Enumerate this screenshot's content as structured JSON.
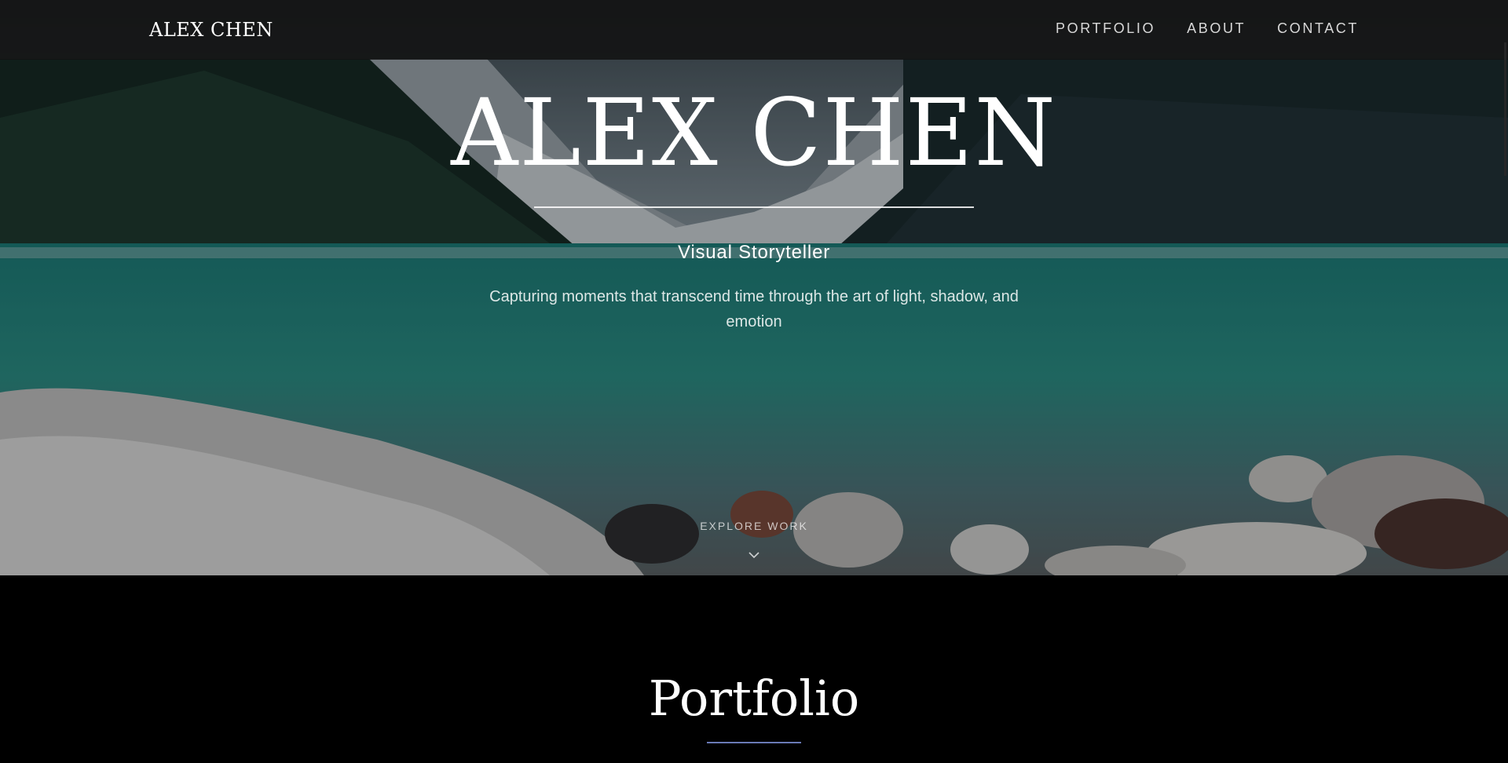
{
  "nav": {
    "brand": "ALEX CHEN",
    "links": [
      "PORTFOLIO",
      "ABOUT",
      "CONTACT"
    ]
  },
  "hero": {
    "title": "ALEX CHEN",
    "subtitle": "Visual Storyteller",
    "tagline": "Capturing moments that transcend time through the art of light, shadow, and emotion",
    "explore_label": "EXPLORE WORK",
    "chevron_icon": "chevron-down-icon"
  },
  "portfolio": {
    "title": "Portfolio",
    "accent_color": "#6a7ab6"
  }
}
